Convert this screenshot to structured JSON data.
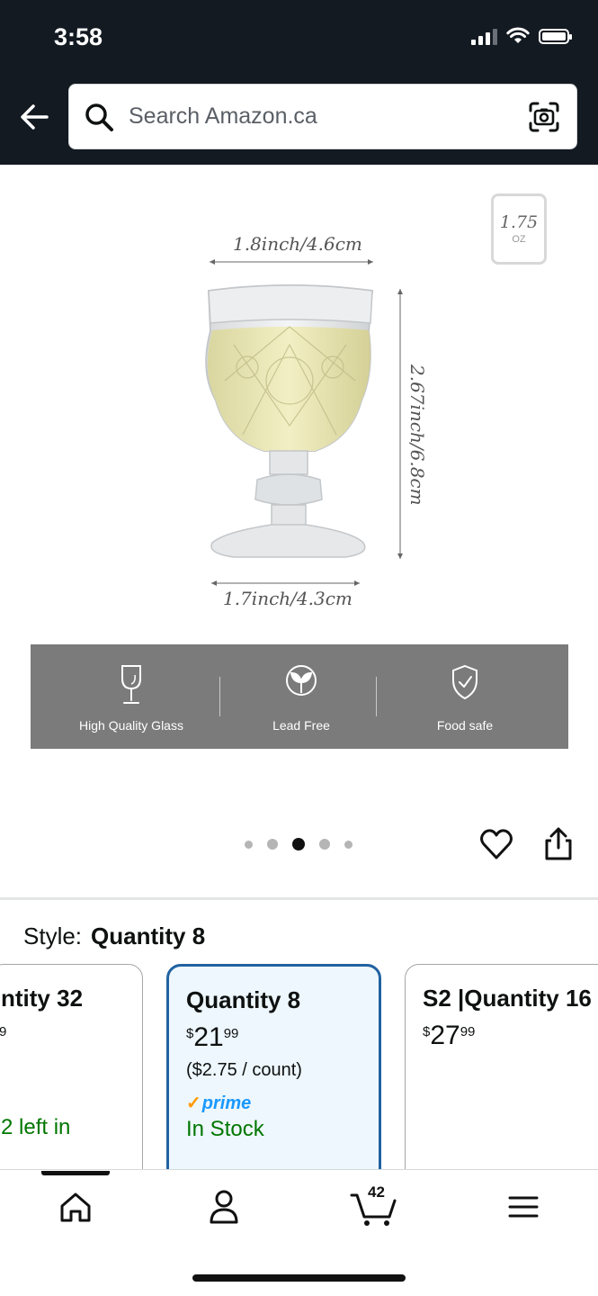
{
  "status_bar": {
    "time": "3:58"
  },
  "header": {
    "search_placeholder": "Search Amazon.ca"
  },
  "product_image": {
    "top_width": "1.8inch/4.6cm",
    "height": "2.67inch/6.8cm",
    "base_width": "1.7inch/4.3cm",
    "capacity_value": "1.75",
    "capacity_unit": "OZ",
    "features": [
      {
        "label": "High Quality Glass",
        "icon": "wine-glass-icon"
      },
      {
        "label": "Lead Free",
        "icon": "leaf-icon"
      },
      {
        "label": "Food safe",
        "icon": "shield-check-icon"
      }
    ],
    "carousel": {
      "count": 5,
      "active_index": 2
    }
  },
  "style": {
    "label": "Style:",
    "selected": "Quantity 8",
    "options": [
      {
        "title": "ntity 32",
        "price_fraction": "9",
        "stock": "2 left in"
      },
      {
        "title": "Quantity 8",
        "price_symbol": "$",
        "price_whole": "21",
        "price_fraction": "99",
        "unit_price": "($2.75 / count)",
        "prime": "prime",
        "stock": "In Stock"
      },
      {
        "title": "S2 |Quantity 16",
        "price_symbol": "$",
        "price_whole": "27",
        "price_fraction": "99"
      }
    ]
  },
  "bottom_nav": {
    "cart_count": "42",
    "items": [
      "home-icon",
      "account-icon",
      "cart-icon",
      "menu-icon"
    ]
  },
  "colors": {
    "header_bg": "#131a22",
    "selected_border": "#2162a1",
    "selected_bg": "#edf7fd",
    "in_stock": "#007600",
    "prime_blue": "#1a98ff"
  }
}
